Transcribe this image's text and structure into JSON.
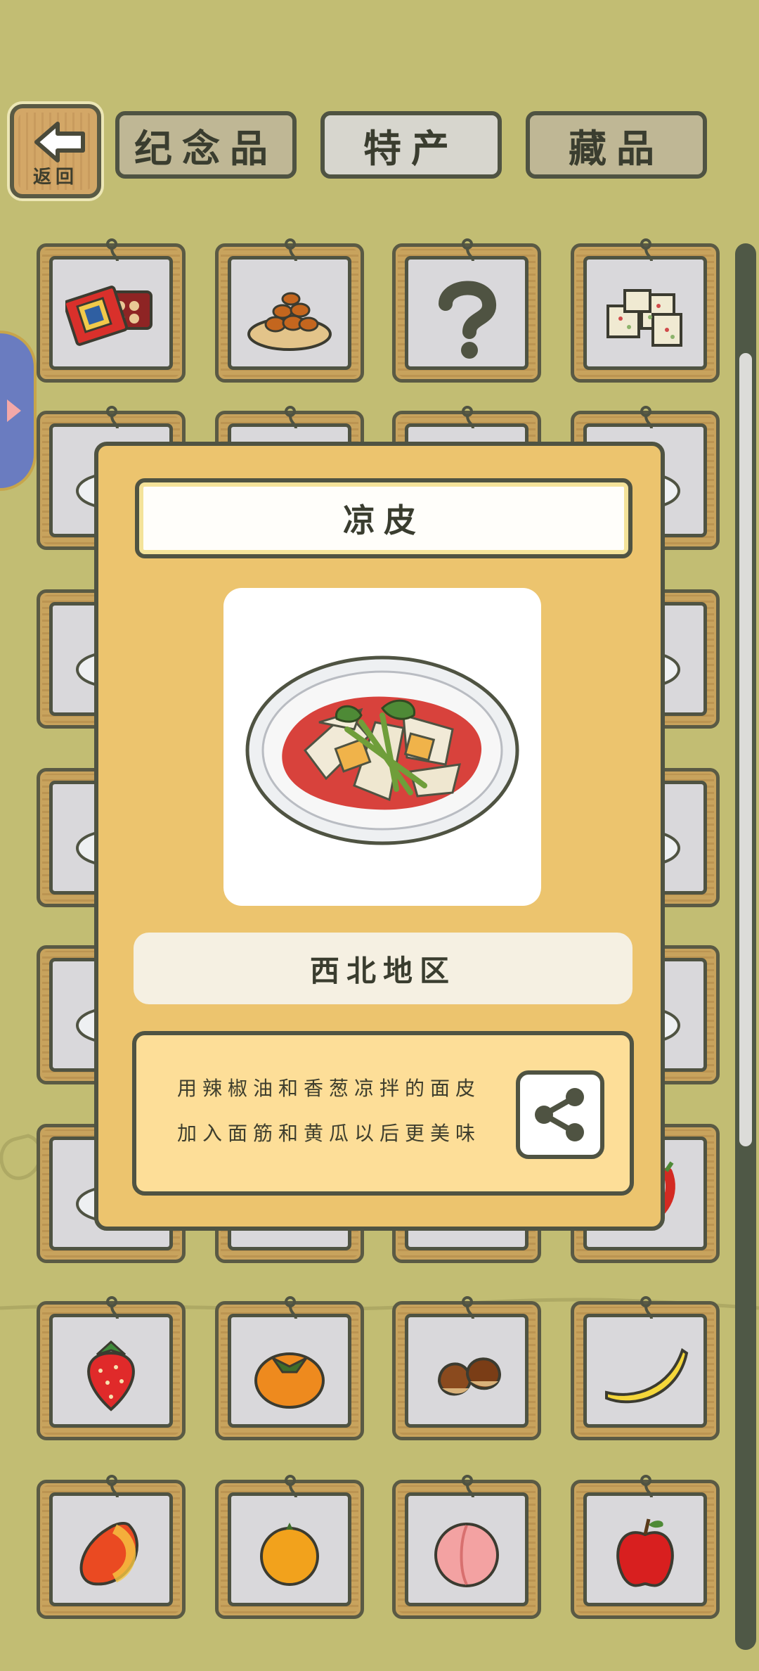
{
  "back_button": {
    "label": "返回"
  },
  "tabs": [
    {
      "label": "纪念品",
      "state": "inactive"
    },
    {
      "label": "特产",
      "state": "active"
    },
    {
      "label": "藏品",
      "state": "inactive"
    }
  ],
  "grid_items": [
    {
      "icon": "gift-box-icon"
    },
    {
      "icon": "fried-dough-plate-icon"
    },
    {
      "icon": "question-mark-icon"
    },
    {
      "icon": "nougat-icon"
    },
    {
      "icon": "food-icon"
    },
    {
      "icon": "food-icon"
    },
    {
      "icon": "food-icon"
    },
    {
      "icon": "food-icon"
    },
    {
      "icon": "food-icon"
    },
    {
      "icon": "food-icon"
    },
    {
      "icon": "food-icon"
    },
    {
      "icon": "food-icon"
    },
    {
      "icon": "food-icon"
    },
    {
      "icon": "food-icon"
    },
    {
      "icon": "food-icon"
    },
    {
      "icon": "food-icon"
    },
    {
      "icon": "food-icon"
    },
    {
      "icon": "food-icon"
    },
    {
      "icon": "food-icon"
    },
    {
      "icon": "food-icon"
    },
    {
      "icon": "food-icon"
    },
    {
      "icon": "food-icon"
    },
    {
      "icon": "food-icon"
    },
    {
      "icon": "chili-icon"
    },
    {
      "icon": "strawberry-icon"
    },
    {
      "icon": "persimmon-icon"
    },
    {
      "icon": "chestnut-icon"
    },
    {
      "icon": "banana-icon"
    },
    {
      "icon": "mango-icon"
    },
    {
      "icon": "orange-icon"
    },
    {
      "icon": "peach-icon"
    },
    {
      "icon": "apple-icon"
    }
  ],
  "detail_modal": {
    "title": "凉皮",
    "image_icon": "liangpi-plate-icon",
    "region": "西北地区",
    "description_line1": "用辣椒油和香葱凉拌的面皮",
    "description_line2": "加入面筋和黄瓜以后更美味",
    "share_icon": "share-icon"
  },
  "colors": {
    "background": "#c2bd73",
    "modal": "#ecc46e",
    "description_box": "#fdde98",
    "border": "#4f5342"
  }
}
